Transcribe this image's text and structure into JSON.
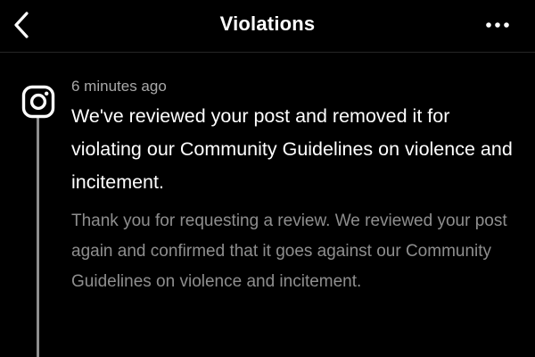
{
  "header": {
    "title": "Violations",
    "back_icon": "chevron-left-icon",
    "more_icon": "more-horizontal-icon"
  },
  "notification": {
    "app_icon": "instagram-icon",
    "timestamp": "6 minutes ago",
    "headline": "We've reviewed your post and removed it for violating our Community Guidelines on violence and incitement.",
    "body": "Thank you for requesting a review. We reviewed your post again and confirmed that it goes against our Community Guidelines on violence and incitement."
  },
  "colors": {
    "background": "#000000",
    "primary_text": "#ffffff",
    "secondary_text": "#a8a8a8",
    "timeline": "#8e8e8e"
  }
}
